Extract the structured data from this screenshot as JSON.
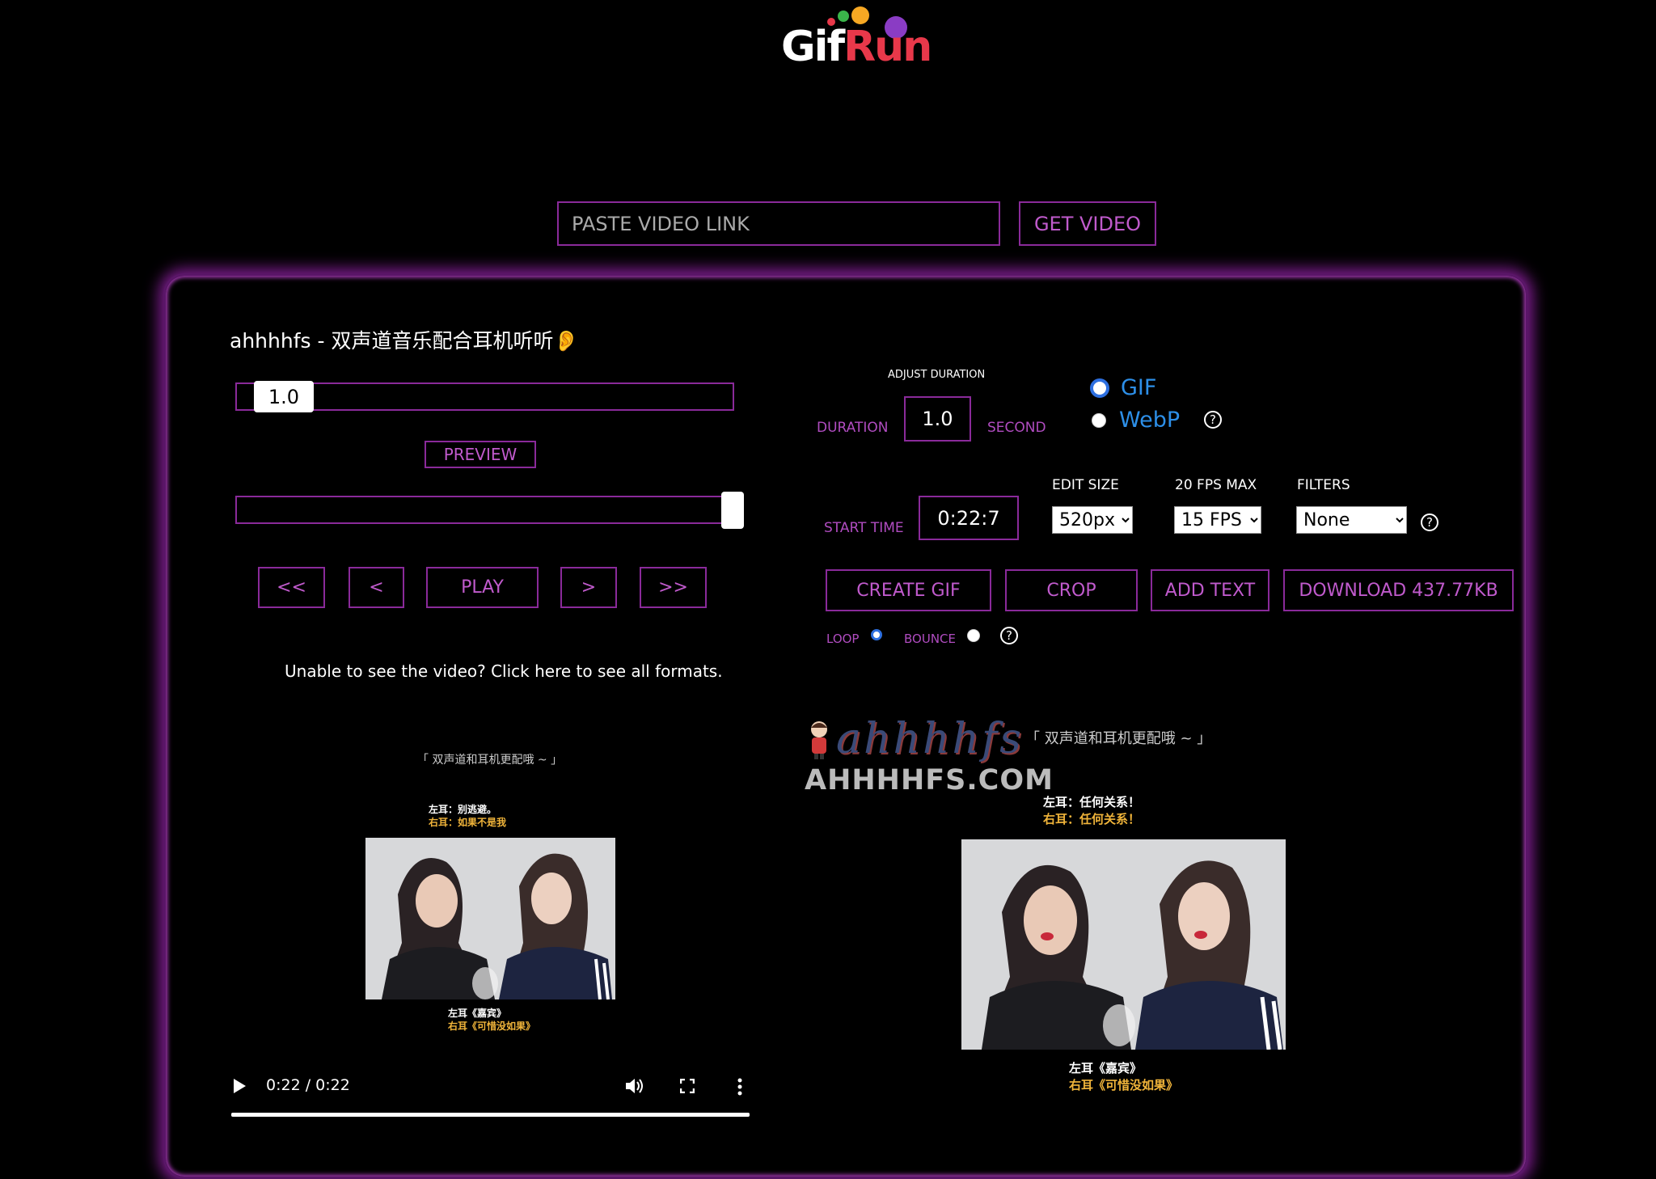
{
  "logo": {
    "text_gif": "Gif",
    "text_run": "Run"
  },
  "link_bar": {
    "placeholder": "PASTE VIDEO LINK",
    "button": "GET VIDEO"
  },
  "video": {
    "title": "ahhhhfs - 双声道音乐配合耳机听听👂",
    "speed_value": "1.0",
    "preview_label": "PREVIEW",
    "nav": {
      "back_far": "<<",
      "back": "<",
      "play": "PLAY",
      "fwd": ">",
      "fwd_far": ">>"
    },
    "formats_note": "Unable to see the video? Click here to see all formats.",
    "player": {
      "time": "0:22 / 0:22",
      "progress": 1.0
    },
    "frame_caption_top": "「 双声道和耳机更配哦 ~ 」",
    "frame_left_line": "左耳：别逃避。",
    "frame_right_line": "右耳：如果不是我",
    "frame_song_left": "左耳《嘉宾》",
    "frame_song_right": "右耳《可惜没如果》"
  },
  "controls": {
    "adjust_duration_label": "ADJUST DURATION",
    "duration_label": "DURATION",
    "duration_value": "1.0",
    "second_label": "SECOND",
    "format_options": [
      {
        "label": "GIF",
        "selected": true
      },
      {
        "label": "WebP",
        "selected": false
      }
    ],
    "start_time_label": "START TIME",
    "start_time_value": "0:22:7",
    "edit_size_label": "EDIT SIZE",
    "edit_size_value": "520px",
    "fps_label": "20 FPS MAX",
    "fps_value": "15 FPS",
    "filters_label": "FILTERS",
    "filters_value": "None",
    "actions": {
      "create": "CREATE GIF",
      "crop": "CROP",
      "add_text": "ADD TEXT",
      "download": "DOWNLOAD 437.77KB"
    },
    "loop_label": "LOOP",
    "bounce_label": "BOUNCE",
    "help_glyph": "?"
  },
  "gif_preview": {
    "watermark": "ahhhhfs",
    "watermark_domain": "AHHHHFS.COM",
    "caption_top": "「 双声道和耳机更配哦 ~ 」",
    "left_line": "左耳：任何关系！",
    "right_line": "右耳：任何关系！",
    "song_left": "左耳《嘉宾》",
    "song_right": "右耳《可惜没如果》"
  },
  "colors": {
    "accent": "#8a2a9a",
    "accent_text": "#c05acc",
    "radio_blue": "#2d6fe0",
    "format_text": "#2d8fe8"
  }
}
